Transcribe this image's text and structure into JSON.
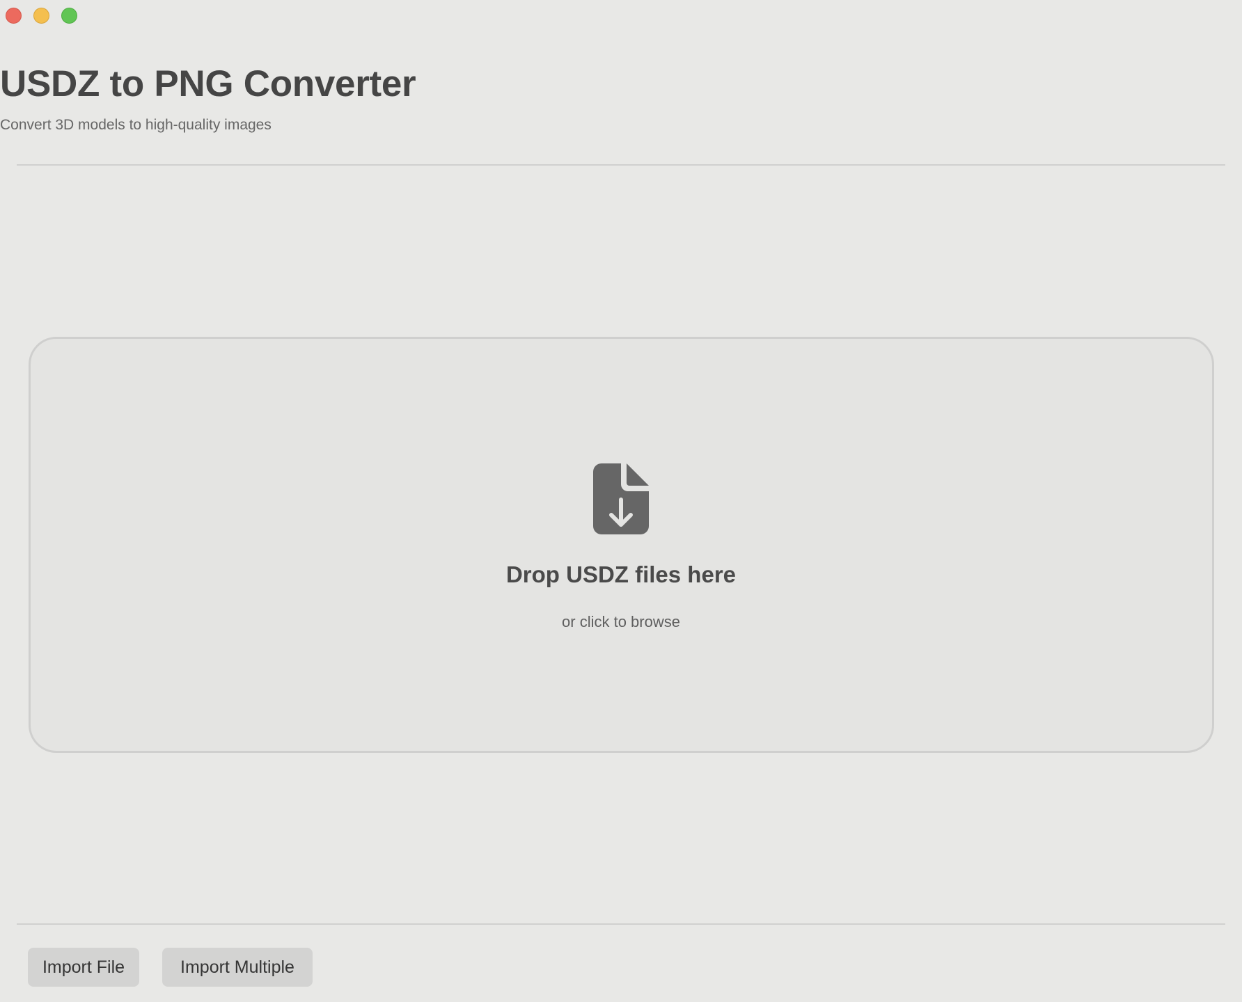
{
  "window": {
    "controls": [
      "close",
      "minimize",
      "zoom"
    ]
  },
  "header": {
    "title": "USDZ to PNG Converter",
    "subtitle": "Convert 3D models to high-quality images"
  },
  "dropzone": {
    "icon": "document-download-icon",
    "title": "Drop USDZ files here",
    "hint": "or click to browse"
  },
  "footer": {
    "import_file_label": "Import File",
    "import_multiple_label": "Import Multiple"
  },
  "colors": {
    "background": "#e8e8e6",
    "title": "#454545",
    "icon": "#666666",
    "button": "#d3d3d2",
    "close": "#ec6a5e",
    "minimize": "#f4bf4f",
    "zoom": "#61c554"
  }
}
